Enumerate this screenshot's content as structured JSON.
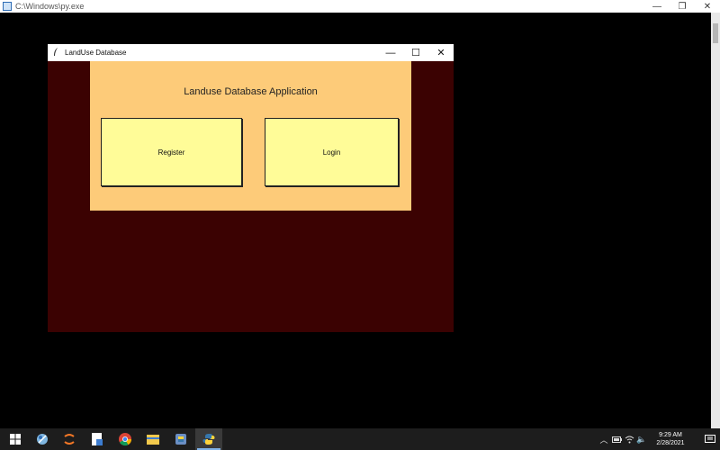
{
  "console": {
    "title": "C:\\Windows\\py.exe",
    "controls": {
      "minimize": "—",
      "restore": "❐",
      "close": "✕"
    }
  },
  "app": {
    "title": "LandUse Database",
    "controls": {
      "minimize": "—",
      "maximize": "☐",
      "close": "✕"
    },
    "heading": "Landuse Database Application",
    "register_label": "Register",
    "login_label": "Login",
    "colors": {
      "background": "#3b0202",
      "panel": "#fdcb79",
      "button": "#fffc98"
    }
  },
  "taskbar": {
    "icons": [
      "windows-start-icon",
      "snipping-tool-icon",
      "jupyter-icon",
      "file-explorer-pdf-icon",
      "chrome-icon",
      "file-explorer-icon",
      "python-idle-icon",
      "python-icon"
    ],
    "tray": {
      "chevron": "︿",
      "volume": "🔈",
      "time": "9:29 AM",
      "date": "2/28/2021",
      "notifications_count": "1"
    }
  }
}
